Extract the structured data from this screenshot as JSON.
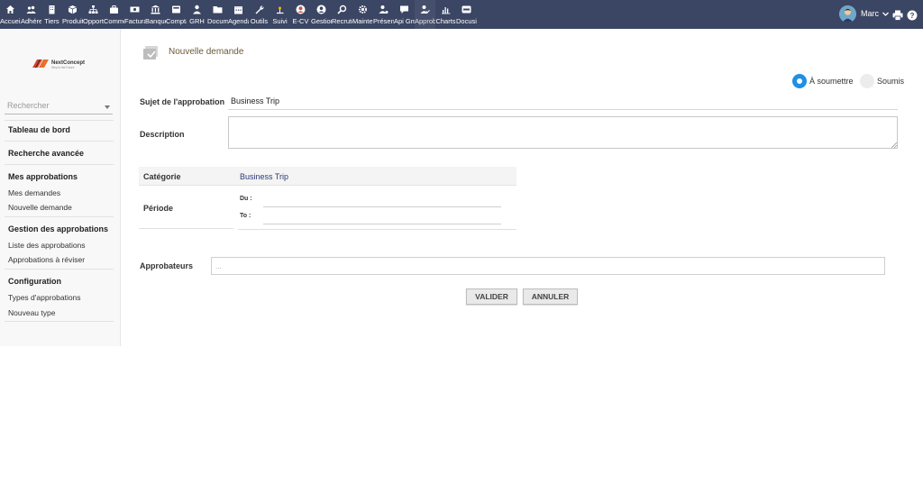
{
  "nav": [
    {
      "label": "Accueil",
      "icon": "home-icon"
    },
    {
      "label": "Adhérents",
      "icon": "users-icon"
    },
    {
      "label": "Tiers",
      "icon": "building-icon"
    },
    {
      "label": "Produits",
      "icon": "cube-icon"
    },
    {
      "label": "Opportunités",
      "icon": "sitemap-icon"
    },
    {
      "label": "Commercial",
      "icon": "briefcase-icon"
    },
    {
      "label": "Facturation",
      "icon": "money-icon"
    },
    {
      "label": "Banque",
      "icon": "bank-icon"
    },
    {
      "label": "Compta",
      "icon": "calculator-icon"
    },
    {
      "label": "GRH",
      "icon": "user-tie-icon"
    },
    {
      "label": "Documents",
      "icon": "folder-icon"
    },
    {
      "label": "Agenda",
      "icon": "calendar-icon"
    },
    {
      "label": "Outils",
      "icon": "wrench-icon"
    },
    {
      "label": "Suivi",
      "icon": "tracking-icon"
    },
    {
      "label": "E-CV",
      "icon": "profile-icon"
    },
    {
      "label": "Gestion",
      "icon": "user-circle-icon"
    },
    {
      "label": "Recrutement",
      "icon": "magnifier-icon"
    },
    {
      "label": "Maintenance",
      "icon": "cog-icon"
    },
    {
      "label": "Présences",
      "icon": "presence-icon"
    },
    {
      "label": "Api Gmail",
      "icon": "chat-bubble-icon"
    },
    {
      "label": "Approbations",
      "icon": "approval-icon",
      "active": true
    },
    {
      "label": "Charts",
      "icon": "chart-icon"
    },
    {
      "label": "Docusign",
      "icon": "docusign-icon"
    }
  ],
  "user": {
    "name": "Marc"
  },
  "sidebar": {
    "logo_text": "NextConcept",
    "logo_tagline": "Step to the Future",
    "search_placeholder": "Rechercher",
    "dashboard": "Tableau de bord",
    "advanced_search": "Recherche avancée",
    "my_approvals": {
      "title": "Mes approbations",
      "items": [
        "Mes demandes",
        "Nouvelle demande"
      ]
    },
    "management": {
      "title": "Gestion des approbations",
      "items": [
        "Liste des approbations",
        "Approbations à réviser"
      ]
    },
    "config": {
      "title": "Configuration",
      "items": [
        "Types d'approbations",
        "Nouveau type"
      ]
    }
  },
  "page": {
    "title": "Nouvelle demande"
  },
  "status": {
    "option_a": "À soumettre",
    "option_b": "Soumis",
    "selected": "À soumettre"
  },
  "form": {
    "subject_label": "Sujet de l'approbation",
    "subject_value": "Business Trip",
    "description_label": "Description",
    "description_value": "",
    "category_label": "Catégorie",
    "category_value": "Business Trip",
    "period_label": "Période",
    "from_label": "Du :",
    "to_label": "To :",
    "approvers_label": "Approbateurs",
    "approvers_placeholder": "..."
  },
  "buttons": {
    "submit": "VALIDER",
    "cancel": "ANNULER"
  },
  "colors": {
    "topbar": "#3b4664",
    "radio_selected": "#1e90e6",
    "category_value": "#2a3a7a"
  }
}
